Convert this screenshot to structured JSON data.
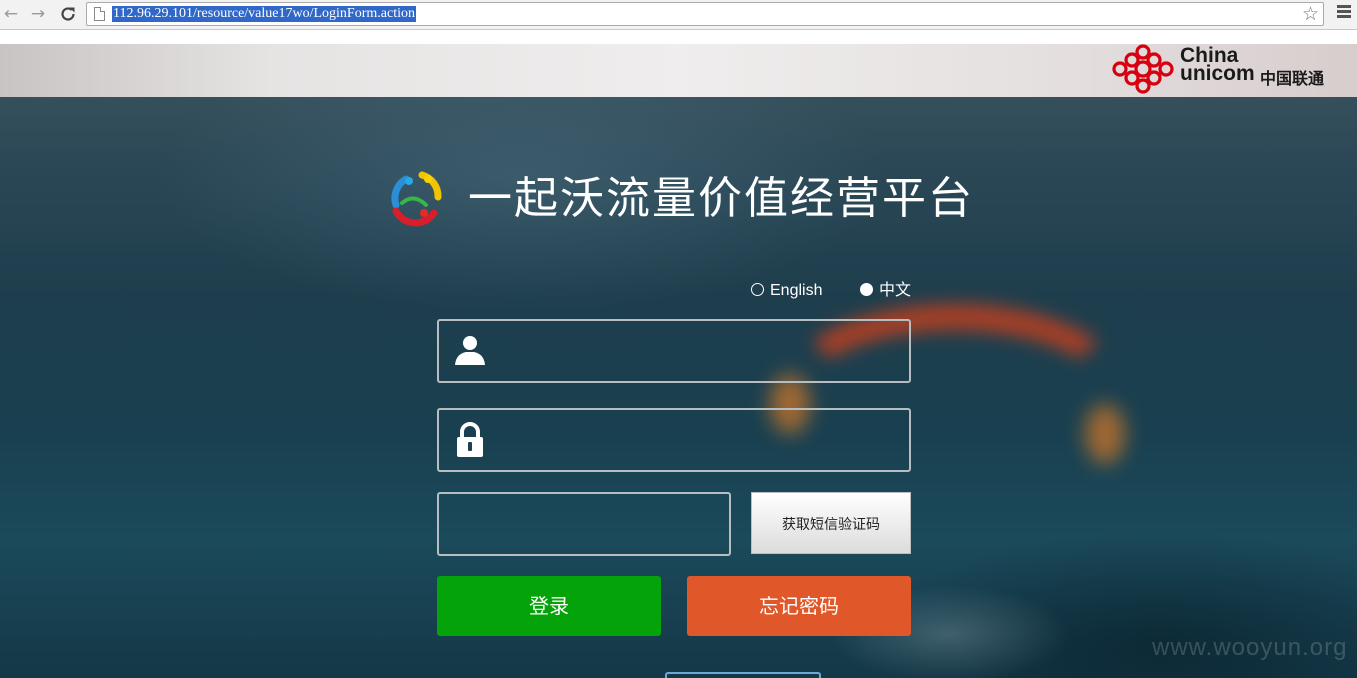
{
  "browser": {
    "back_icon": "arrow-left-icon",
    "forward_icon": "arrow-right-icon",
    "reload_icon": "reload-icon",
    "url": "112.96.29.101/resource/value17wo/LoginForm.action",
    "bookmark_icon": "star-icon",
    "menu_icon": "menu-icon"
  },
  "header": {
    "brand_name_line1": "China",
    "brand_name_line2": "unicom",
    "brand_name_cn": "中国联通"
  },
  "main": {
    "title": "一起沃流量价值经营平台",
    "language_options": [
      {
        "label": "English",
        "selected": false
      },
      {
        "label": "中文",
        "selected": true
      }
    ],
    "username": {
      "value": "",
      "placeholder": "",
      "icon": "user-icon"
    },
    "password": {
      "value": "",
      "placeholder": "",
      "icon": "lock-icon"
    },
    "sms_code": {
      "value": "",
      "placeholder": ""
    },
    "sms_button_label": "获取短信验证码",
    "login_button_label": "登录",
    "forgot_button_label": "忘记密码"
  },
  "watermark": "www.wooyun.org",
  "colors": {
    "login_green": "#05a30a",
    "forgot_orange": "#e0582a",
    "unicom_red": "#d7000f",
    "url_selection": "#3168c8"
  }
}
